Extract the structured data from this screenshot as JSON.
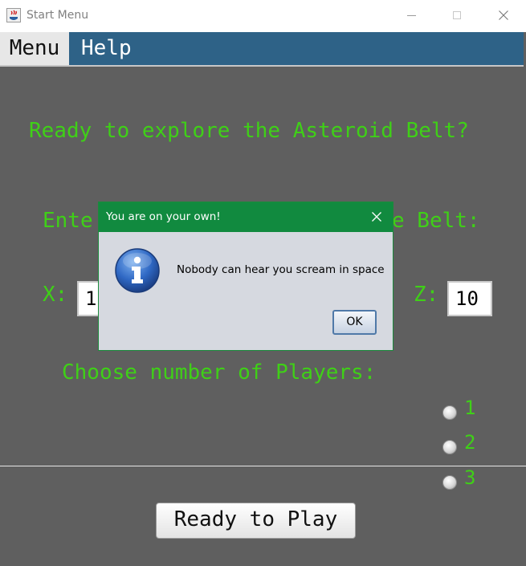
{
  "window": {
    "title": "Start Menu"
  },
  "menubar": {
    "menu_label": "Menu",
    "help_label": "Help"
  },
  "main": {
    "heading": "Ready to explore the Asteroid Belt?",
    "enter_prefix": "Ente",
    "enter_suffix": "e Belt:",
    "x_label": "X:",
    "x_value": "1",
    "z_label": "Z:",
    "z_value": "10",
    "players_label": "Choose number of Players:",
    "player_options": [
      "1",
      "2",
      "3"
    ],
    "play_button": "Ready to Play"
  },
  "dialog": {
    "title": "You are on your own!",
    "message": "Nobody can hear you scream in space",
    "ok_label": "OK"
  },
  "colors": {
    "label_green": "#3fd017",
    "background": "#5f5f5f",
    "menubar_blue": "#2e6287",
    "dialog_titlebar": "#118a3f"
  },
  "icons": {
    "app": "java-coffee-icon",
    "dialog": "info-icon"
  }
}
